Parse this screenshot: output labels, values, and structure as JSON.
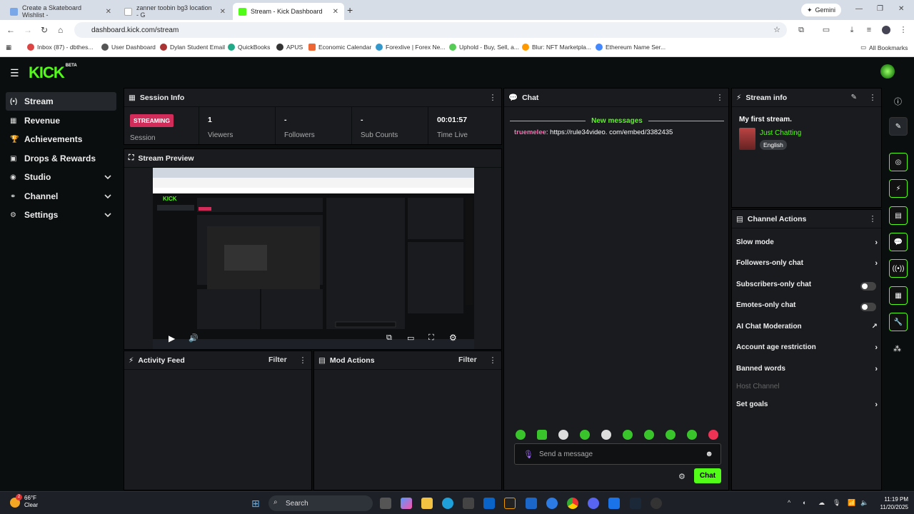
{
  "browser": {
    "tabs": [
      {
        "title": "Create a Skateboard Wishlist -",
        "active": false
      },
      {
        "title": "zanner toobin bg3 location - G",
        "active": false
      },
      {
        "title": "Stream - Kick Dashboard",
        "active": true
      }
    ],
    "gemini_label": "Gemini",
    "url": "dashboard.kick.com/stream",
    "bookmarks": [
      "Inbox (87) - dbthes...",
      "User Dashboard",
      "Dylan Student Email",
      "QuickBooks",
      "APUS",
      "Economic Calendar",
      "Forexlive | Forex Ne...",
      "Uphold - Buy, Sell, a...",
      "Blur: NFT Marketpla...",
      "Ethereum Name Ser..."
    ],
    "all_bookmarks": "All Bookmarks"
  },
  "app": {
    "logo": "KICK",
    "logo_badge": "BETA",
    "accent": "#53fc18"
  },
  "sidebar": {
    "items": [
      {
        "label": "Stream",
        "icon": "stream-icon",
        "glyph": "(•)",
        "active": true,
        "expandable": false
      },
      {
        "label": "Revenue",
        "icon": "revenue-icon",
        "glyph": "▦",
        "active": false,
        "expandable": false
      },
      {
        "label": "Achievements",
        "icon": "trophy-icon",
        "glyph": "🏆",
        "active": false,
        "expandable": false
      },
      {
        "label": "Drops & Rewards",
        "icon": "gift-icon",
        "glyph": "▣",
        "active": false,
        "expandable": false
      },
      {
        "label": "Studio",
        "icon": "studio-icon",
        "glyph": "◉",
        "active": false,
        "expandable": true
      },
      {
        "label": "Channel",
        "icon": "channel-icon",
        "glyph": "⚭",
        "active": false,
        "expandable": true
      },
      {
        "label": "Settings",
        "icon": "gear-icon",
        "glyph": "⚙",
        "active": false,
        "expandable": true
      }
    ]
  },
  "session": {
    "title": "Session Info",
    "status_badge": "STREAMING",
    "status_label": "Session",
    "stats": [
      {
        "value": "1",
        "label": "Viewers"
      },
      {
        "value": "-",
        "label": "Followers"
      },
      {
        "value": "-",
        "label": "Sub Counts"
      },
      {
        "value": "00:01:57",
        "label": "Time Live"
      }
    ]
  },
  "preview": {
    "title": "Stream Preview"
  },
  "activity": {
    "title": "Activity Feed",
    "filter": "Filter"
  },
  "mod": {
    "title": "Mod Actions",
    "filter": "Filter"
  },
  "chat": {
    "title": "Chat",
    "new_messages": "New messages",
    "messages": [
      {
        "user": "truemelee",
        "text": "https://rule34video. com/embed/3382435"
      }
    ],
    "placeholder": "Send a message",
    "send_label": "Chat"
  },
  "stream_info": {
    "title": "Stream info",
    "stream_title": "My first stream.",
    "category": "Just Chatting",
    "language": "English"
  },
  "channel_actions": {
    "title": "Channel Actions",
    "items": [
      {
        "label": "Slow mode",
        "control": "arrow"
      },
      {
        "label": "Followers-only chat",
        "control": "arrow"
      },
      {
        "label": "Subscribers-only chat",
        "control": "toggle"
      },
      {
        "label": "Emotes-only chat",
        "control": "toggle"
      },
      {
        "label": "AI Chat Moderation",
        "control": "external"
      },
      {
        "label": "Account age restriction",
        "control": "arrow"
      },
      {
        "label": "Banned words",
        "control": "arrow"
      },
      {
        "label": "Host Channel",
        "control": "disabled"
      },
      {
        "label": "Set goals",
        "control": "arrow"
      }
    ]
  },
  "taskbar": {
    "temperature": "66°F",
    "condition": "Clear",
    "weather_badge": "2",
    "search_placeholder": "Search",
    "time": "11:19 PM",
    "date": "11/20/2025"
  }
}
